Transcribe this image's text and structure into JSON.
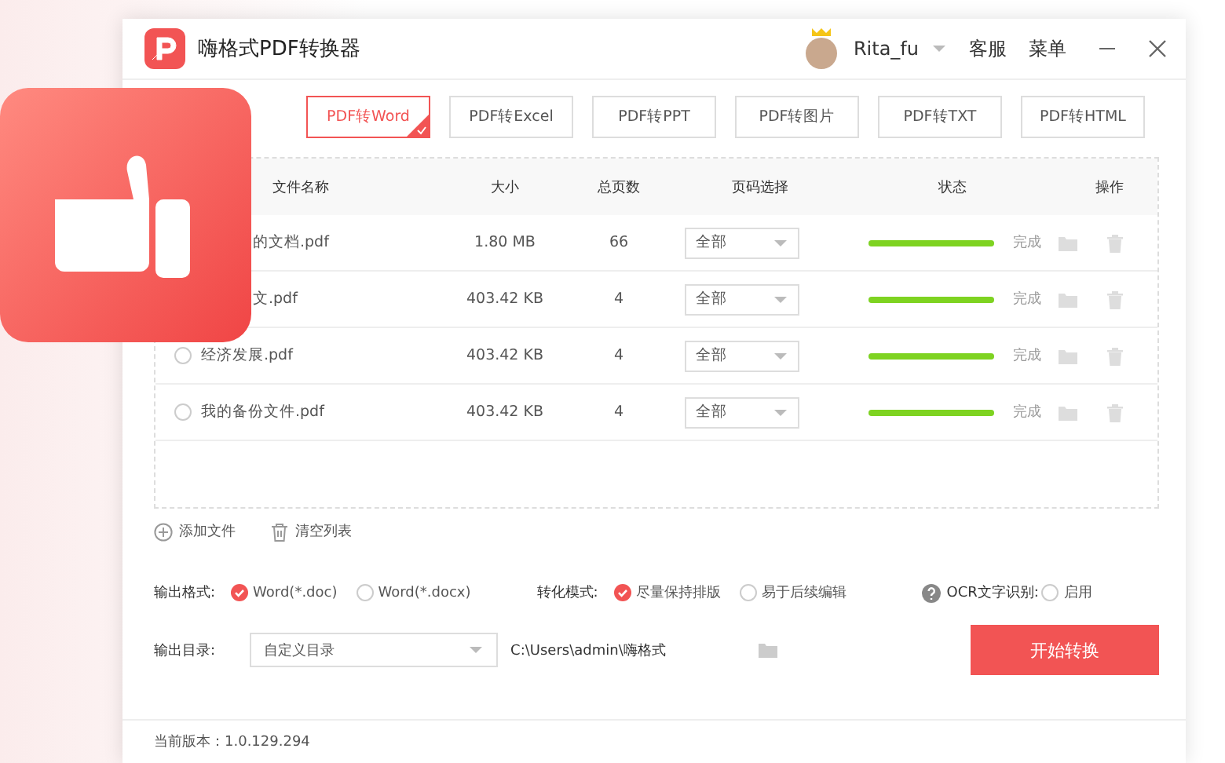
{
  "window": {
    "title": "嗨格式PDF转换器",
    "user": "Rita_fu",
    "menu": [
      "客服",
      "菜单"
    ]
  },
  "tabs": [
    {
      "label": "PDF转Word",
      "selected": true
    },
    {
      "label": "PDF转Excel",
      "selected": false
    },
    {
      "label": "PDF转PPT",
      "selected": false
    },
    {
      "label": "PDF转图片",
      "selected": false
    },
    {
      "label": "PDF转TXT",
      "selected": false
    },
    {
      "label": "PDF转HTML",
      "selected": false
    }
  ],
  "table": {
    "columns": [
      "文件名称",
      "大小",
      "总页数",
      "页码选择",
      "状态",
      "操作"
    ],
    "rows": [
      {
        "name": "的文档.pdf",
        "size": "1.80 MB",
        "pages": "66",
        "range": "全部",
        "level": 1,
        "status": "完成"
      },
      {
        "name": "文.pdf",
        "size": "403.42 KB",
        "pages": "4",
        "range": "全部",
        "level": 1,
        "status": "完成"
      },
      {
        "name": "经济发展.pdf",
        "selected": false,
        "size": "403.42 KB",
        "pages": "4",
        "range": "全部",
        "level": 1,
        "status": "完成"
      },
      {
        "name": "我的备份文件.pdf",
        "selected": false,
        "size": "403.42 KB",
        "pages": "4",
        "range": "全部",
        "level": 1,
        "status": "完成"
      }
    ]
  },
  "actions": [
    "添加文件",
    "清空列表"
  ],
  "output_format": {
    "label": "输出格式:",
    "options": [
      {
        "label": "Word(*.doc)",
        "selected": true
      },
      {
        "label": "Word(*.docx)",
        "selected": false
      }
    ]
  },
  "convert_mode": {
    "label": "转化模式:",
    "options": [
      {
        "label": "尽量保持排版",
        "selected": true
      },
      {
        "label": "易于后续编辑",
        "selected": false
      }
    ]
  },
  "ocr": {
    "label": "OCR文字识别:",
    "option": "启用",
    "checked": false
  },
  "output_dir": {
    "label": "输出目录:",
    "value": "自定义目录",
    "path": "C:\\Users\\admin\\嗨格式"
  },
  "start_button": "开始转换",
  "status_bar": "当前版本：1.0.129.294"
}
